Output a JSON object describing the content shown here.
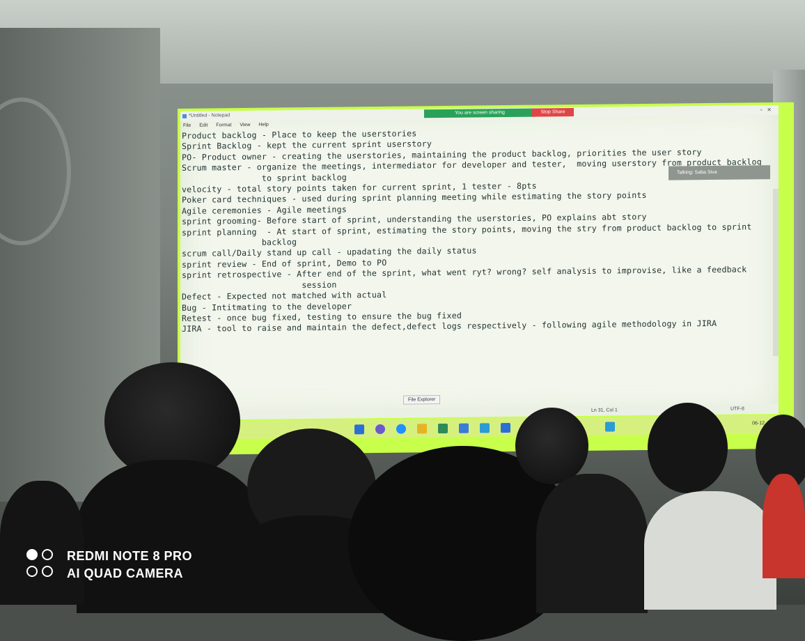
{
  "notepad": {
    "title": "*Untitled - Notepad",
    "menu": [
      "File",
      "Edit",
      "Format",
      "View",
      "Help"
    ],
    "sharing_label": "You are screen sharing",
    "stop_share_label": "Stop Share",
    "talking_label": "Talking: Saba Siva",
    "lines": [
      "Product backlog - Place to keep the userstories",
      "Sprint Backlog - kept the current sprint userstory",
      "PO- Product owner - creating the userstories, maintaining the product backlog, priorities the user story",
      "Scrum master - organize the meetings, intermediator for developer and tester,  moving userstory from product backlog",
      "                to sprint backlog",
      "velocity - total story points taken for current sprint, 1 tester - 8pts",
      "Poker card techniques - used during sprint planning meeting while estimating the story points",
      "Agile ceremonies - Agile meetings",
      "sprint grooming- Before start of sprint, understanding the userstories, PO explains abt story",
      "sprint planning  - At start of sprint, estimating the story points, moving the stry from product backlog to sprint",
      "                backlog",
      "scrum call/Daily stand up call - upadating the daily status",
      "sprint review - End of sprint, Demo to PO",
      "sprint retrospective - After end of the sprint, what went ryt? wrong? self analysis to improvise, like a feedback",
      "                        session",
      "Defect - Expected not matched with actual",
      "Bug - Intitmating to the developer",
      "Retest - once bug fixed, testing to ensure the bug fixed",
      "JIRA - tool to raise and maintain the defect,defect logs respectively - following agile methodology in JIRA"
    ],
    "status_position": "Ln 31, Col 1",
    "status_encoding": "UTF-8",
    "tooltip": "File Explorer"
  },
  "taskbar": {
    "icon_colors": [
      "#2b6fd6",
      "#6a5acd",
      "#1e90ff",
      "#e6b422",
      "#2e8b57",
      "#3a7bd5",
      "#2b9bd6",
      "#2b6fd6"
    ],
    "tray_date": "06-12"
  },
  "watermark": {
    "line1": "REDMI NOTE 8 PRO",
    "line2": "AI QUAD CAMERA"
  }
}
